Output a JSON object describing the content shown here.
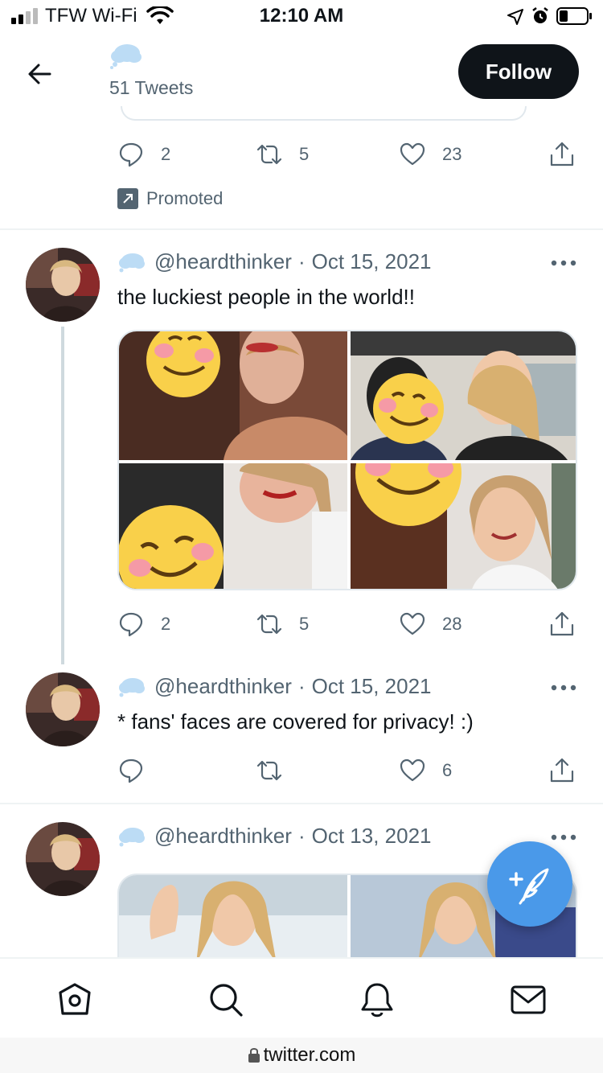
{
  "status_bar": {
    "carrier": "TFW Wi-Fi",
    "time": "12:10 AM"
  },
  "header": {
    "back_icon": "arrow-left-icon",
    "tweet_count": "51 Tweets",
    "follow_label": "Follow"
  },
  "promoted_tweet": {
    "replies": "2",
    "retweets": "5",
    "likes": "23",
    "promoted_label": "Promoted"
  },
  "tweets": [
    {
      "handle": "@heardthinker",
      "separator": "·",
      "date": "Oct 15, 2021",
      "text": "the luckiest people in the world!!",
      "replies": "2",
      "retweets": "5",
      "likes": "28"
    },
    {
      "handle": "@heardthinker",
      "separator": "·",
      "date": "Oct 15, 2021",
      "text": "* fans' faces are covered for privacy! :)",
      "replies": "",
      "retweets": "",
      "likes": "6"
    },
    {
      "handle": "@heardthinker",
      "separator": "·",
      "date": "Oct 13, 2021"
    }
  ],
  "bottom_nav": {
    "items": [
      "home-icon",
      "search-icon",
      "notifications-icon",
      "messages-icon"
    ]
  },
  "url_bar": {
    "url": "twitter.com"
  },
  "colors": {
    "accent": "#4a99e9",
    "text_secondary": "#536471",
    "follow_bg": "#0f1419",
    "divider": "#eff3f4"
  }
}
